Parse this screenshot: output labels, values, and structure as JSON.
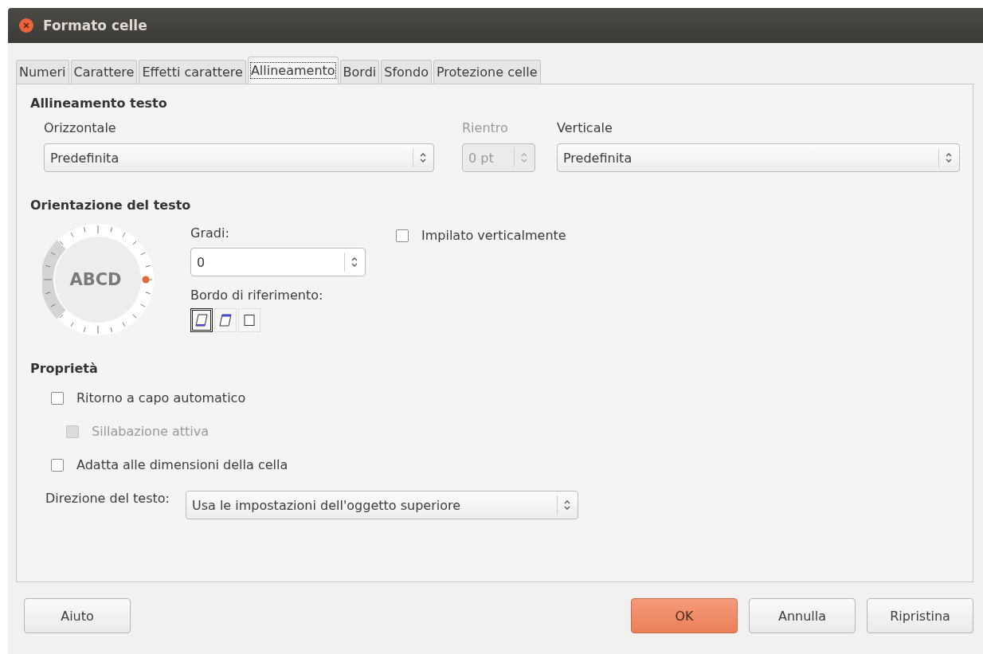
{
  "window": {
    "title": "Formato celle"
  },
  "tabs": [
    {
      "label": "Numeri",
      "selected": false
    },
    {
      "label": "Carattere",
      "selected": false
    },
    {
      "label": "Effetti carattere",
      "selected": false
    },
    {
      "label": "Allineamento",
      "selected": true
    },
    {
      "label": "Bordi",
      "selected": false
    },
    {
      "label": "Sfondo",
      "selected": false
    },
    {
      "label": "Protezione celle",
      "selected": false
    }
  ],
  "text_alignment": {
    "title": "Allineamento testo",
    "horizontal": {
      "label": "Orizzontale",
      "value": "Predefinita"
    },
    "indent": {
      "label": "Rientro",
      "value": "0 pt",
      "disabled": true
    },
    "vertical": {
      "label": "Verticale",
      "value": "Predefinita"
    }
  },
  "orientation": {
    "title": "Orientazione del testo",
    "dial_text": "ABCD",
    "degrees": {
      "label": "Gradi:",
      "value": "0"
    },
    "reference_edge": {
      "label": "Bordo di riferimento:",
      "options": [
        {
          "kind": "bottom",
          "selected": true
        },
        {
          "kind": "top",
          "selected": false
        },
        {
          "kind": "cell",
          "selected": false
        }
      ]
    },
    "stacked": {
      "label": "Impilato verticalmente",
      "checked": false
    }
  },
  "properties": {
    "title": "Proprietà",
    "options": [
      {
        "label": "Ritorno a capo automatico",
        "checked": false,
        "disabled": false,
        "children": [
          {
            "label": "Sillabazione attiva",
            "checked": false,
            "disabled": true
          }
        ]
      },
      {
        "label": "Adatta alle dimensioni della cella",
        "checked": false,
        "disabled": false
      }
    ],
    "text_direction": {
      "label": "Direzione del testo:",
      "value": "Usa le impostazioni dell'oggetto superiore"
    }
  },
  "buttons": [
    {
      "label": "Aiuto",
      "default": false
    },
    {
      "label": "OK",
      "default": true
    },
    {
      "label": "Annulla",
      "default": false
    },
    {
      "label": "Ripristina",
      "default": false
    }
  ]
}
